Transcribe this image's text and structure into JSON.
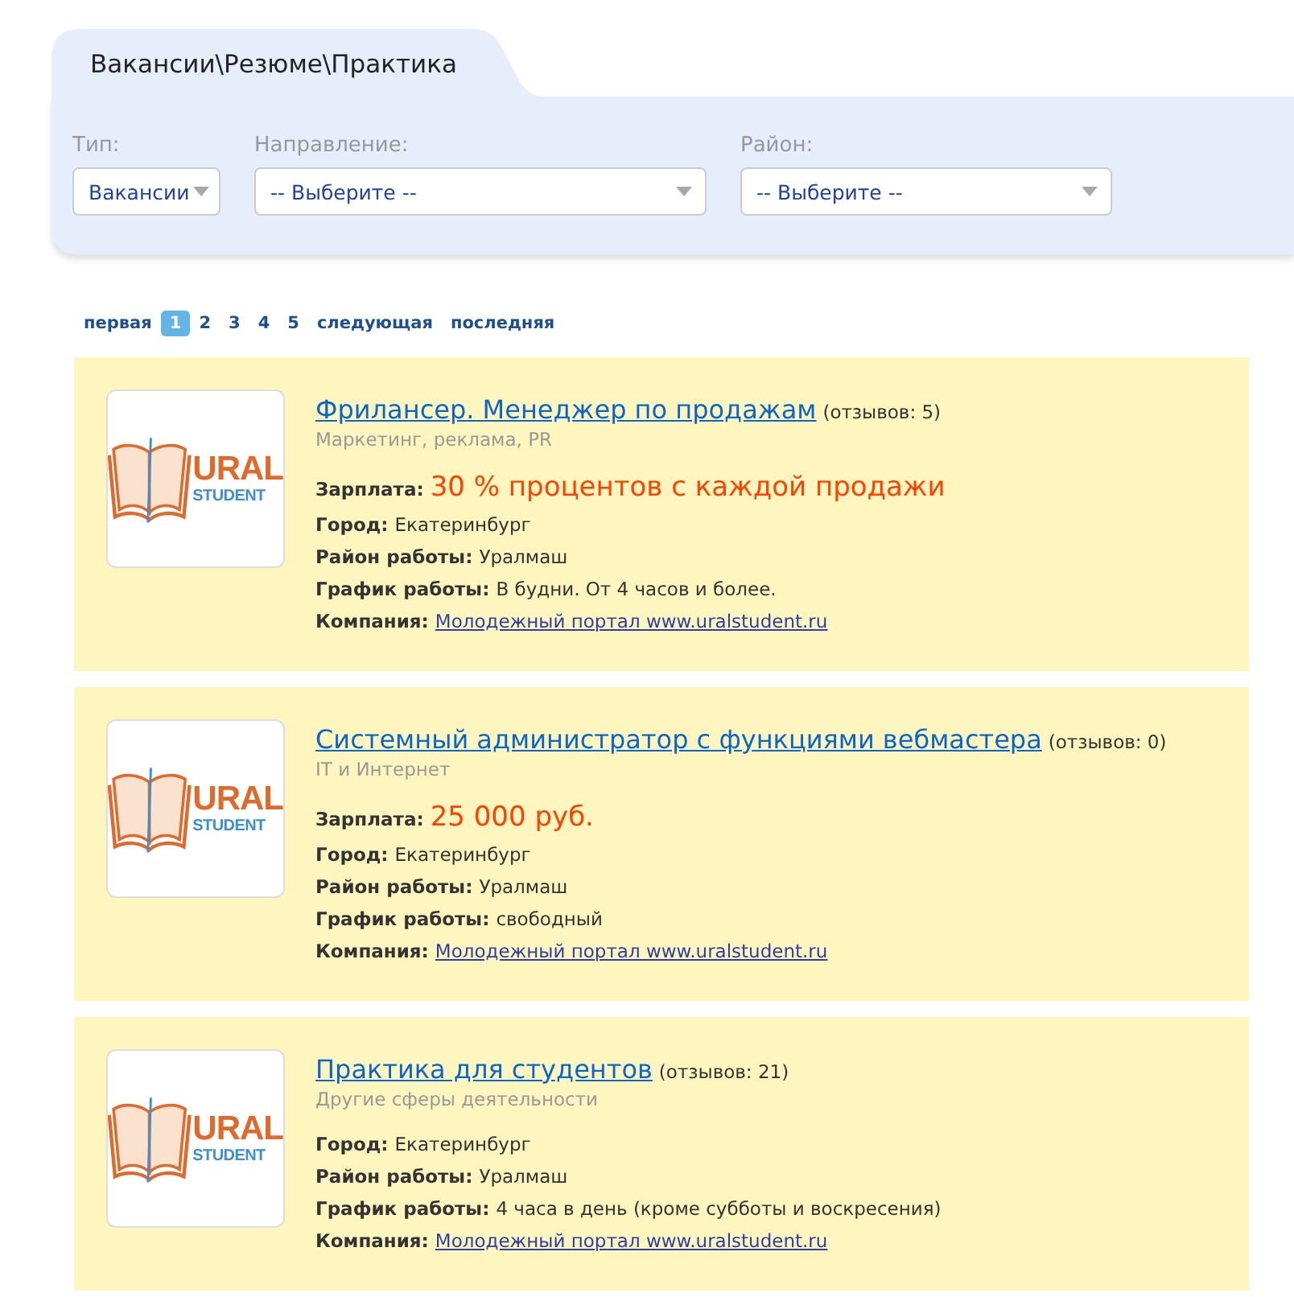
{
  "panel": {
    "title": "Вакансии\\Резюме\\Практика",
    "filters": [
      {
        "label": "Тип:",
        "value": "Вакансии"
      },
      {
        "label": "Направление:",
        "value": "-- Выберите --"
      },
      {
        "label": "Район:",
        "value": "-- Выберите --"
      }
    ]
  },
  "pagination": {
    "items": [
      {
        "label": "первая",
        "selected": false
      },
      {
        "label": "1",
        "selected": true
      },
      {
        "label": "2",
        "selected": false
      },
      {
        "label": "3",
        "selected": false
      },
      {
        "label": "4",
        "selected": false
      },
      {
        "label": "5",
        "selected": false
      },
      {
        "label": "следующая",
        "selected": false
      },
      {
        "label": "последняя",
        "selected": false
      }
    ]
  },
  "jobs": [
    {
      "logo": {
        "line_1": "URAL",
        "line_2": "STUDENT"
      },
      "title": "Фрилансер. Менеджер по продажам",
      "reviews": "(отзывов: 5)",
      "category": "Маркетинг, реклама, PR",
      "details": [
        {
          "kind": "salary",
          "label": "Зарплата:",
          "value": "30 % процентов с каждой продажи"
        },
        {
          "kind": "text",
          "label": "Город:",
          "value": "Екатеринбург"
        },
        {
          "kind": "text",
          "label": "Район работы:",
          "value": "Уралмаш"
        },
        {
          "kind": "text",
          "label": "График работы:",
          "value": "В будни. От 4 часов и более."
        },
        {
          "kind": "link",
          "label": "Компания:",
          "value": "Молодежный портал www.uralstudent.ru"
        }
      ]
    },
    {
      "logo": {
        "line_1": "URAL",
        "line_2": "STUDENT"
      },
      "title": "Системный администратор с функциями вебмастера",
      "reviews": "(отзывов: 0)",
      "category": "IT и Интернет",
      "details": [
        {
          "kind": "salary",
          "label": "Зарплата:",
          "value": "25 000 руб."
        },
        {
          "kind": "text",
          "label": "Город:",
          "value": "Екатеринбург"
        },
        {
          "kind": "text",
          "label": "Район работы:",
          "value": "Уралмаш"
        },
        {
          "kind": "text",
          "label": "График работы:",
          "value": "свободный"
        },
        {
          "kind": "link",
          "label": "Компания:",
          "value": "Молодежный портал www.uralstudent.ru"
        }
      ]
    },
    {
      "logo": {
        "line_1": "URAL",
        "line_2": "STUDENT"
      },
      "title": "Практика для студентов",
      "reviews": "(отзывов: 21)",
      "category": "Другие сферы деятельности",
      "details": [
        {
          "kind": "text",
          "label": "Город:",
          "value": "Екатеринбург"
        },
        {
          "kind": "text",
          "label": "Район работы:",
          "value": "Уралмаш"
        },
        {
          "kind": "text",
          "label": "График работы:",
          "value": "4 часа в день (кроме субботы и воскресения)"
        },
        {
          "kind": "link",
          "label": "Компания:",
          "value": "Молодежный портал www.uralstudent.ru"
        }
      ]
    }
  ]
}
